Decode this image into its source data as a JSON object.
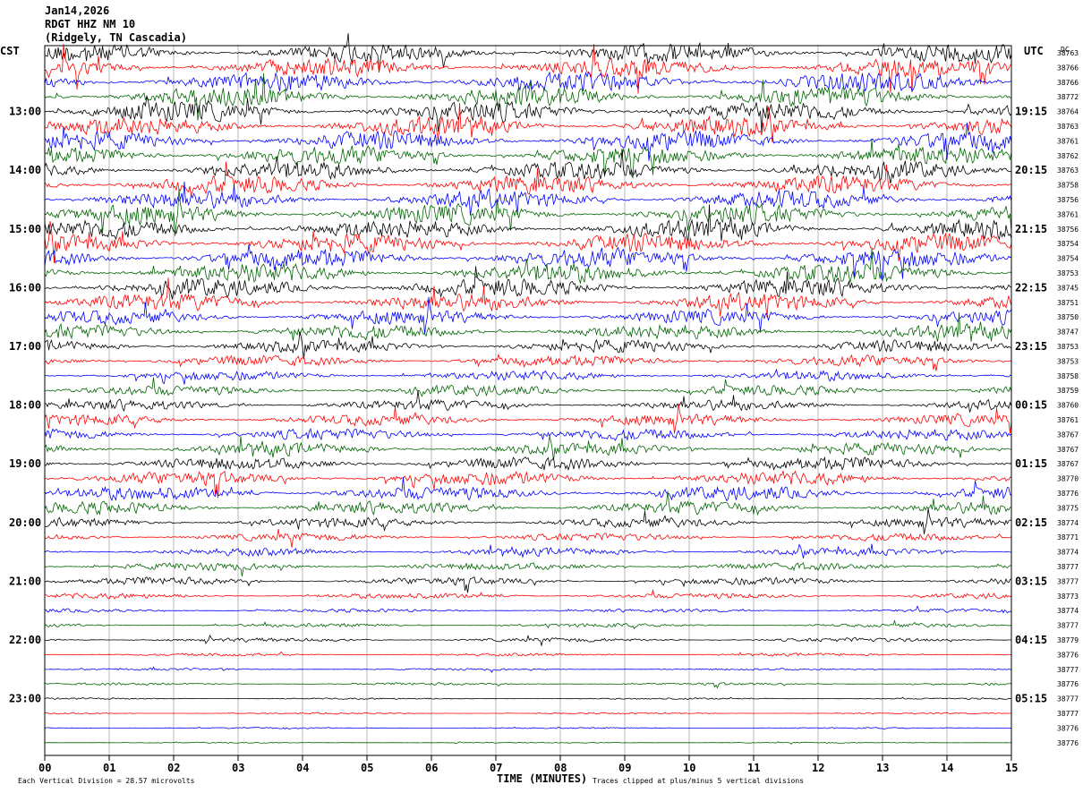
{
  "header": {
    "date": "Jan14,2026",
    "channel": "RDGT HHZ NM 10",
    "location": "(Ridgely, TN Cascadia)"
  },
  "axes": {
    "left_label": "CST",
    "right_label": "UTC",
    "dc_label": "DC",
    "x_title": "TIME (MINUTES)"
  },
  "footer": {
    "scale_note": "Each Vertical Division =   28.57 microvolts",
    "clip_note": "Traces clipped at plus/minus 5 vertical divisions"
  },
  "chart_data": {
    "type": "line",
    "title": "RDGT HHZ NM 10",
    "xlabel": "TIME (MINUTES)",
    "ylabel": "",
    "x_range": [
      0,
      15
    ],
    "x_ticks": [
      "00",
      "01",
      "02",
      "03",
      "04",
      "05",
      "06",
      "07",
      "08",
      "09",
      "10",
      "11",
      "12",
      "13",
      "14",
      "15"
    ],
    "trace_minutes": 15,
    "trace_colors": [
      "#000000",
      "#ff0000",
      "#0000ff",
      "#006400"
    ],
    "left_time_labels": [
      {
        "row": 4,
        "label": "13:00"
      },
      {
        "row": 8,
        "label": "14:00"
      },
      {
        "row": 12,
        "label": "15:00"
      },
      {
        "row": 16,
        "label": "16:00"
      },
      {
        "row": 20,
        "label": "17:00"
      },
      {
        "row": 24,
        "label": "18:00"
      },
      {
        "row": 28,
        "label": "19:00"
      },
      {
        "row": 32,
        "label": "20:00"
      },
      {
        "row": 36,
        "label": "21:00"
      },
      {
        "row": 40,
        "label": "22:00"
      },
      {
        "row": 44,
        "label": "23:00"
      }
    ],
    "right_time_labels": [
      {
        "row": 4,
        "label": "19:15"
      },
      {
        "row": 8,
        "label": "20:15"
      },
      {
        "row": 12,
        "label": "21:15"
      },
      {
        "row": 16,
        "label": "22:15"
      },
      {
        "row": 20,
        "label": "23:15"
      },
      {
        "row": 24,
        "label": "00:15"
      },
      {
        "row": 28,
        "label": "01:15"
      },
      {
        "row": 32,
        "label": "02:15"
      },
      {
        "row": 36,
        "label": "03:15"
      },
      {
        "row": 40,
        "label": "04:15"
      },
      {
        "row": 44,
        "label": "05:15"
      }
    ],
    "dc_offsets": [
      "38763",
      "38766",
      "38766",
      "38772",
      "38764",
      "38763",
      "38761",
      "38762",
      "38763",
      "38758",
      "38756",
      "38761",
      "38756",
      "38754",
      "38754",
      "38753",
      "38745",
      "38751",
      "38750",
      "38747",
      "38753",
      "38753",
      "38758",
      "38759",
      "38760",
      "38761",
      "38767",
      "38767",
      "38767",
      "38770",
      "38776",
      "38775",
      "38774",
      "38771",
      "38774",
      "38777",
      "38777",
      "38773",
      "38774",
      "38777",
      "38779",
      "38776",
      "38777",
      "38776",
      "38777",
      "38777",
      "38776",
      "38776"
    ],
    "relative_activity": [
      1.35,
      1.35,
      1.4,
      1.4,
      1.4,
      1.35,
      1.35,
      1.35,
      1.3,
      1.3,
      1.3,
      1.35,
      1.35,
      1.35,
      1.4,
      1.4,
      1.3,
      1.25,
      1.0,
      1.05,
      0.9,
      0.8,
      0.7,
      0.75,
      0.75,
      0.8,
      0.8,
      0.85,
      0.95,
      1.0,
      1.0,
      0.9,
      0.7,
      0.55,
      0.55,
      0.55,
      0.55,
      0.4,
      0.25,
      0.28,
      0.3,
      0.2,
      0.15,
      0.18,
      0.12,
      0.1,
      0.1,
      0.08
    ]
  }
}
